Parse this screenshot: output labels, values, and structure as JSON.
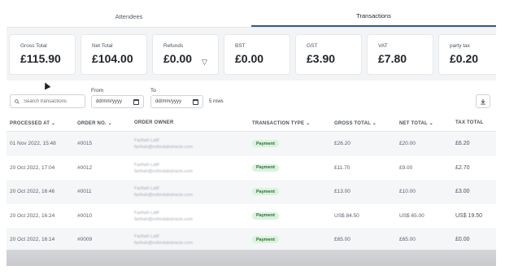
{
  "tabs": [
    {
      "label": "Attendees",
      "active": false
    },
    {
      "label": "Transactions",
      "active": true
    }
  ],
  "summary": [
    {
      "label": "Gross Total",
      "value": "£115.90"
    },
    {
      "label": "Net Total",
      "value": "£104.00"
    },
    {
      "label": "Refunds",
      "value": "£0.00",
      "icon": "filter-icon"
    },
    {
      "label": "BST",
      "value": "£0.00"
    },
    {
      "label": "GST",
      "value": "£3.90"
    },
    {
      "label": "VAT",
      "value": "£7.80"
    },
    {
      "label": "party tax",
      "value": "£0.20"
    }
  ],
  "toolbar": {
    "search_placeholder": "Search transactions",
    "from_label": "From",
    "to_label": "To",
    "date_placeholder": "dd/mm/yyyy",
    "rows_count": "5 rows"
  },
  "table": {
    "headers": {
      "processed_at": "PROCESSED AT ⌄",
      "order_no": "ORDER NO. ⌄",
      "order_owner": "ORDER OWNER",
      "transaction_type": "TRANSACTION TYPE ⌄",
      "gross_total": "GROSS TOTAL ⌄",
      "net_total": "NET TOTAL ⌄",
      "tax_total": "TAX TOTAL"
    },
    "rows": [
      {
        "processed_at": "01 Nov 2022, 15:48",
        "order_no": "#0015",
        "owner_name": "Farihah Latif",
        "owner_email": "farihah@oxfordabstracts.com",
        "type": "Payment",
        "gross": "£26.20",
        "net": "£20.00",
        "tax": "£6.20"
      },
      {
        "processed_at": "20 Oct 2022, 17:04",
        "order_no": "#0012",
        "owner_name": "Farihah Latif",
        "owner_email": "farihah@oxfordabstracts.com",
        "type": "Payment",
        "gross": "£11.70",
        "net": "£9.00",
        "tax": "£2.70"
      },
      {
        "processed_at": "20 Oct 2022, 16:46",
        "order_no": "#0011",
        "owner_name": "Farihah Latif",
        "owner_email": "farihah@oxfordabstracts.com",
        "type": "Payment",
        "gross": "£13.00",
        "net": "£10.00",
        "tax": "£3.00"
      },
      {
        "processed_at": "20 Oct 2022, 16:24",
        "order_no": "#0010",
        "owner_name": "Farihah Latif",
        "owner_email": "farihah@oxfordabstracts.com",
        "type": "Payment",
        "gross": "US$ 84.50",
        "net": "US$ 65.00",
        "tax": "US$ 19.50"
      },
      {
        "processed_at": "20 Oct 2022, 16:14",
        "order_no": "#0009",
        "owner_name": "Farihah Latif",
        "owner_email": "farihah@oxfordabstracts.com",
        "type": "Payment",
        "gross": "£65.00",
        "net": "£65.00",
        "tax": "£0.00"
      }
    ]
  }
}
